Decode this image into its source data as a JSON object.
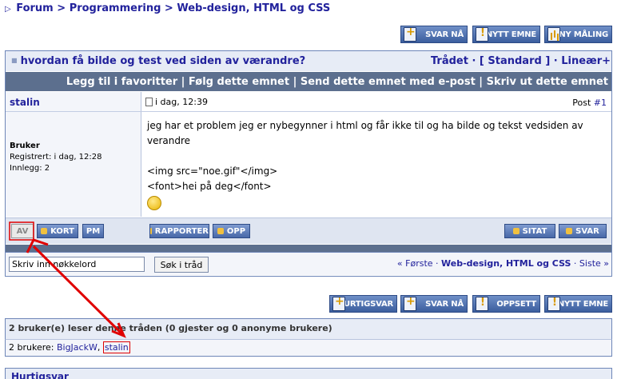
{
  "breadcrumb": {
    "arrow": "▷",
    "items": [
      "Forum",
      "Programmering",
      "Web-design, HTML og CSS"
    ],
    "sep": " > "
  },
  "top_buttons": {
    "reply": "SVAR NÅ",
    "new_topic": "NYTT EMNE",
    "new_poll": "NY MÅLING"
  },
  "thread": {
    "title": "hvordan få bilde og test ved siden av værandre?",
    "mode": "Trådet · [ Standard ] · Lineær+"
  },
  "thread_tools": "Legg til i favoritter | Følg dette emnet | Send dette emnet med e-post | Skriv ut dette emnet",
  "post": {
    "username": "stalin",
    "date": "i dag, 12:39",
    "post_label": "Post ",
    "post_number": "#1",
    "role": "Bruker",
    "registered": "Registrert: i dag, 12:28",
    "posts_count": "Innlegg: 2",
    "body_line1": "jeg har et problem jeg er nybegynner i html og får ikke til og ha bilde og tekst vedsiden av verandre",
    "body_line2": "<img src=\"noe.gif\"</img>",
    "body_line3": "<font>hei på deg</font>"
  },
  "post_buttons": {
    "offline": "AV",
    "card": "KORT",
    "pm": "PM",
    "report": "RAPPORTER",
    "up": "OPP",
    "quote": "SITAT",
    "reply": "SVAR"
  },
  "search": {
    "value": "Skriv inn nøkkelord",
    "button": "Søk i tråd"
  },
  "pager": {
    "first": "« Første",
    "forum": "Web-design, HTML og CSS",
    "last": "Siste »",
    "dot": " · "
  },
  "bottom_buttons": {
    "quick_reply": "HURTIGSVAR",
    "reply": "SVAR NÅ",
    "settings": "OPPSETT",
    "new_topic": "NYTT EMNE"
  },
  "who": {
    "title": "2 bruker(e) leser denne tråden (0 gjester og 0 anonyme brukere)",
    "prefix": "2 brukere: ",
    "users": [
      "BigJackW",
      "stalin"
    ]
  },
  "quick_reply_title": "Hurtigsvar",
  "colors": {
    "link": "#22229c",
    "navbar": "#5c6f8e",
    "annotation": "#e00000"
  }
}
